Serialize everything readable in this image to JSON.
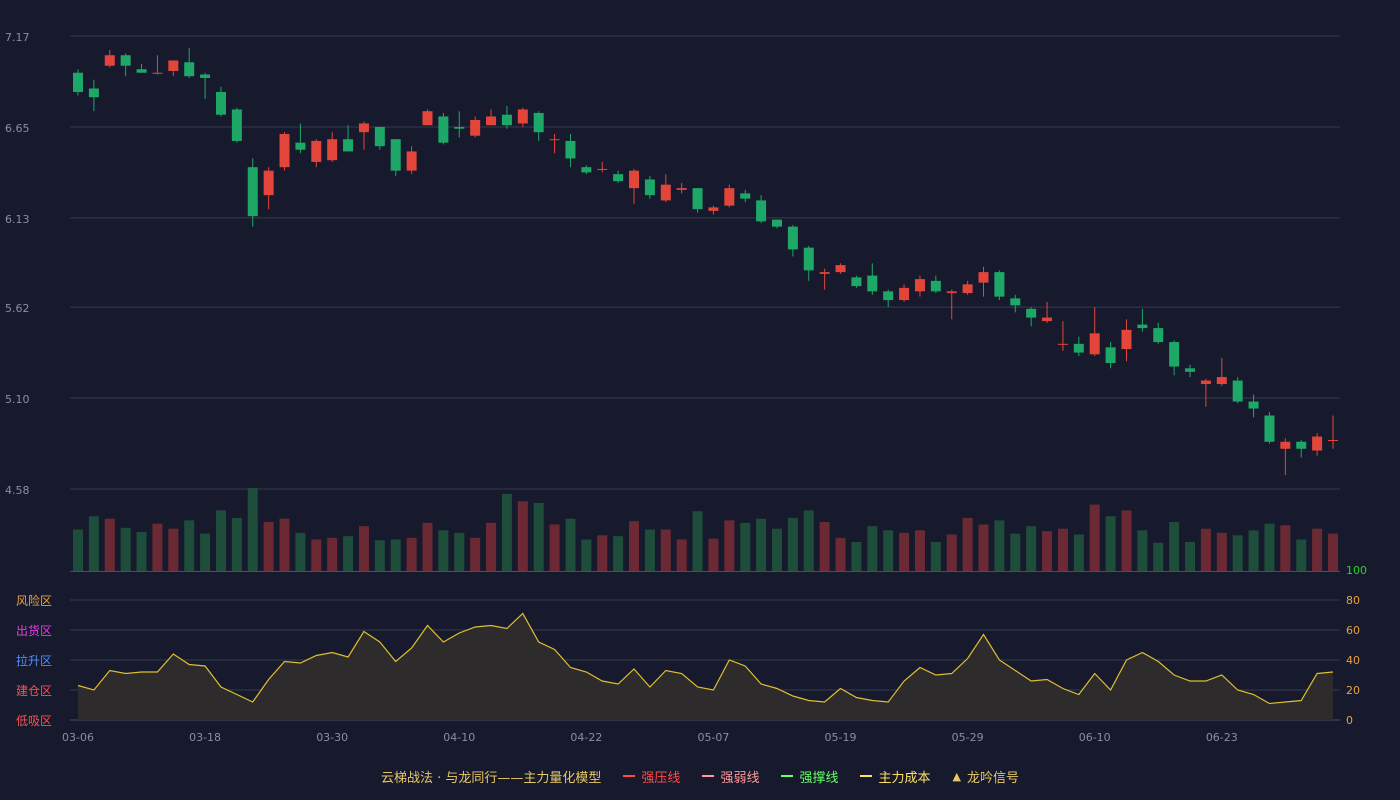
{
  "chart_data": {
    "type": "candlestick",
    "x_tick_labels": [
      "03-06",
      "03-18",
      "03-30",
      "04-10",
      "04-22",
      "05-07",
      "05-19",
      "05-29",
      "06-10",
      "06-23"
    ],
    "x_tick_index": [
      0,
      8,
      16,
      24,
      32,
      40,
      48,
      56,
      64,
      72
    ],
    "price_axis": {
      "ticks": [
        "7.17",
        "6.65",
        "6.13",
        "5.62",
        "5.10",
        "4.58"
      ],
      "min": 4.58,
      "max": 7.17
    },
    "indicator_axis": {
      "ticks": [
        "100",
        "80",
        "60",
        "40",
        "20",
        "0"
      ],
      "min": 0,
      "max": 100
    },
    "zones": [
      {
        "label": "风险区",
        "color": "#f0a040",
        "value": 80
      },
      {
        "label": "出货区",
        "color": "#e040e0",
        "value": 60
      },
      {
        "label": "拉升区",
        "color": "#4f8fff",
        "value": 40
      },
      {
        "label": "建仓区",
        "color": "#ff5050",
        "value": 20
      },
      {
        "label": "低吸区",
        "color": "#ff5050",
        "value": 0
      }
    ],
    "colors": {
      "up": "#e4453b",
      "down": "#1ea868",
      "vol_up": "#6b2a33",
      "vol_down": "#1f4d3b",
      "line": "#e0be30",
      "grid": "#363a4e",
      "axis_text": "#8a8fa0",
      "indicator_axis_text": "#e8a040",
      "indicator_top_text": "#28d428"
    },
    "candles": [
      [
        6.96,
        6.85,
        6.98,
        6.83
      ],
      [
        6.87,
        6.82,
        6.92,
        6.74
      ],
      [
        7.0,
        7.06,
        7.09,
        6.99
      ],
      [
        7.06,
        7.0,
        7.07,
        6.94
      ],
      [
        6.98,
        6.96,
        7.01,
        6.96
      ],
      [
        6.96,
        6.96,
        7.06,
        6.95
      ],
      [
        6.97,
        7.03,
        7.03,
        6.94
      ],
      [
        7.02,
        6.94,
        7.1,
        6.93
      ],
      [
        6.95,
        6.93,
        6.96,
        6.81
      ],
      [
        6.85,
        6.72,
        6.88,
        6.71
      ],
      [
        6.75,
        6.57,
        6.76,
        6.56
      ],
      [
        6.42,
        6.14,
        6.47,
        6.08
      ],
      [
        6.26,
        6.4,
        6.42,
        6.18
      ],
      [
        6.42,
        6.61,
        6.62,
        6.4
      ],
      [
        6.56,
        6.52,
        6.67,
        6.5
      ],
      [
        6.45,
        6.57,
        6.58,
        6.42
      ],
      [
        6.46,
        6.58,
        6.62,
        6.45
      ],
      [
        6.58,
        6.51,
        6.66,
        6.51
      ],
      [
        6.62,
        6.67,
        6.68,
        6.52
      ],
      [
        6.65,
        6.54,
        6.65,
        6.52
      ],
      [
        6.58,
        6.4,
        6.58,
        6.37
      ],
      [
        6.4,
        6.51,
        6.54,
        6.38
      ],
      [
        6.66,
        6.74,
        6.75,
        6.66
      ],
      [
        6.71,
        6.56,
        6.73,
        6.55
      ],
      [
        6.65,
        6.64,
        6.74,
        6.59
      ],
      [
        6.6,
        6.69,
        6.71,
        6.59
      ],
      [
        6.66,
        6.71,
        6.75,
        6.66
      ],
      [
        6.72,
        6.66,
        6.77,
        6.64
      ],
      [
        6.67,
        6.75,
        6.76,
        6.65
      ],
      [
        6.73,
        6.62,
        6.74,
        6.57
      ],
      [
        6.58,
        6.58,
        6.61,
        6.5
      ],
      [
        6.57,
        6.47,
        6.61,
        6.42
      ],
      [
        6.42,
        6.39,
        6.43,
        6.38
      ],
      [
        6.41,
        6.41,
        6.45,
        6.39
      ],
      [
        6.38,
        6.34,
        6.4,
        6.33
      ],
      [
        6.3,
        6.4,
        6.41,
        6.21
      ],
      [
        6.35,
        6.26,
        6.37,
        6.24
      ],
      [
        6.23,
        6.32,
        6.38,
        6.22
      ],
      [
        6.29,
        6.3,
        6.33,
        6.27
      ],
      [
        6.3,
        6.18,
        6.3,
        6.16
      ],
      [
        6.17,
        6.19,
        6.2,
        6.15
      ],
      [
        6.2,
        6.3,
        6.32,
        6.19
      ],
      [
        6.27,
        6.24,
        6.29,
        6.22
      ],
      [
        6.23,
        6.11,
        6.26,
        6.1
      ],
      [
        6.12,
        6.08,
        6.12,
        6.07
      ],
      [
        6.08,
        5.95,
        6.09,
        5.91
      ],
      [
        5.96,
        5.83,
        5.97,
        5.77
      ],
      [
        5.81,
        5.82,
        5.84,
        5.72
      ],
      [
        5.82,
        5.86,
        5.87,
        5.81
      ],
      [
        5.79,
        5.74,
        5.8,
        5.73
      ],
      [
        5.8,
        5.71,
        5.87,
        5.69
      ],
      [
        5.71,
        5.66,
        5.72,
        5.62
      ],
      [
        5.66,
        5.73,
        5.75,
        5.65
      ],
      [
        5.71,
        5.78,
        5.8,
        5.68
      ],
      [
        5.77,
        5.71,
        5.8,
        5.7
      ],
      [
        5.7,
        5.71,
        5.72,
        5.55
      ],
      [
        5.7,
        5.75,
        5.77,
        5.69
      ],
      [
        5.76,
        5.82,
        5.85,
        5.68
      ],
      [
        5.82,
        5.68,
        5.83,
        5.66
      ],
      [
        5.67,
        5.63,
        5.69,
        5.59
      ],
      [
        5.61,
        5.56,
        5.62,
        5.51
      ],
      [
        5.54,
        5.56,
        5.65,
        5.53
      ],
      [
        5.41,
        5.41,
        5.54,
        5.37
      ],
      [
        5.41,
        5.36,
        5.45,
        5.34
      ],
      [
        5.35,
        5.47,
        5.62,
        5.34
      ],
      [
        5.39,
        5.3,
        5.42,
        5.27
      ],
      [
        5.38,
        5.49,
        5.55,
        5.31
      ],
      [
        5.52,
        5.5,
        5.61,
        5.48
      ],
      [
        5.5,
        5.42,
        5.53,
        5.41
      ],
      [
        5.42,
        5.28,
        5.43,
        5.23
      ],
      [
        5.27,
        5.25,
        5.29,
        5.22
      ],
      [
        5.18,
        5.2,
        5.21,
        5.05
      ],
      [
        5.18,
        5.22,
        5.33,
        5.17
      ],
      [
        5.2,
        5.08,
        5.22,
        5.07
      ],
      [
        5.08,
        5.04,
        5.12,
        4.99
      ],
      [
        5.0,
        4.85,
        5.02,
        4.84
      ],
      [
        4.81,
        4.85,
        4.87,
        4.66
      ],
      [
        4.85,
        4.81,
        4.86,
        4.76
      ],
      [
        4.8,
        4.88,
        4.9,
        4.77
      ],
      [
        4.86,
        4.86,
        5.0,
        4.81
      ]
    ],
    "volume_ratio": [
      0.5,
      0.66,
      0.63,
      0.52,
      0.47,
      0.57,
      0.51,
      0.61,
      0.45,
      0.73,
      0.64,
      1.0,
      0.59,
      0.63,
      0.46,
      0.38,
      0.4,
      0.42,
      0.54,
      0.37,
      0.38,
      0.4,
      0.58,
      0.49,
      0.46,
      0.4,
      0.58,
      0.93,
      0.84,
      0.82,
      0.56,
      0.63,
      0.38,
      0.43,
      0.42,
      0.6,
      0.5,
      0.5,
      0.38,
      0.72,
      0.39,
      0.61,
      0.58,
      0.63,
      0.51,
      0.64,
      0.73,
      0.59,
      0.4,
      0.35,
      0.54,
      0.49,
      0.46,
      0.49,
      0.35,
      0.44,
      0.64,
      0.56,
      0.61,
      0.45,
      0.54,
      0.48,
      0.51,
      0.44,
      0.8,
      0.66,
      0.73,
      0.49,
      0.34,
      0.59,
      0.35,
      0.51,
      0.46,
      0.43,
      0.49,
      0.57,
      0.55,
      0.38,
      0.51,
      0.45
    ],
    "indicator_values": [
      23,
      20,
      33,
      31,
      32,
      32,
      44,
      37,
      36,
      22,
      17,
      12,
      27,
      39,
      38,
      43,
      45,
      42,
      59,
      52,
      39,
      48,
      63,
      52,
      58,
      62,
      63,
      61,
      71,
      52,
      47,
      35,
      32,
      26,
      24,
      34,
      22,
      33,
      31,
      22,
      20,
      40,
      36,
      24,
      21,
      16,
      13,
      12,
      21,
      15,
      13,
      12,
      26,
      35,
      30,
      31,
      41,
      57,
      40,
      33,
      26,
      27,
      21,
      17,
      31,
      20,
      40,
      45,
      39,
      30,
      26,
      26,
      30,
      20,
      17,
      11,
      12,
      13,
      31,
      32
    ]
  },
  "legend": {
    "title": "云梯战法 · 与龙同行——主力量化模型",
    "items": [
      {
        "label": "强压线",
        "color": "#ff4a4a",
        "style": "solid"
      },
      {
        "label": "强弱线",
        "color": "#ff9a9a",
        "style": "dashed"
      },
      {
        "label": "强撑线",
        "color": "#66ff66",
        "style": "solid"
      },
      {
        "label": "主力成本",
        "color": "#ffe066",
        "style": "dashed"
      },
      {
        "label": "龙吟信号",
        "color": "#e8c766",
        "style": "triangle"
      }
    ]
  }
}
